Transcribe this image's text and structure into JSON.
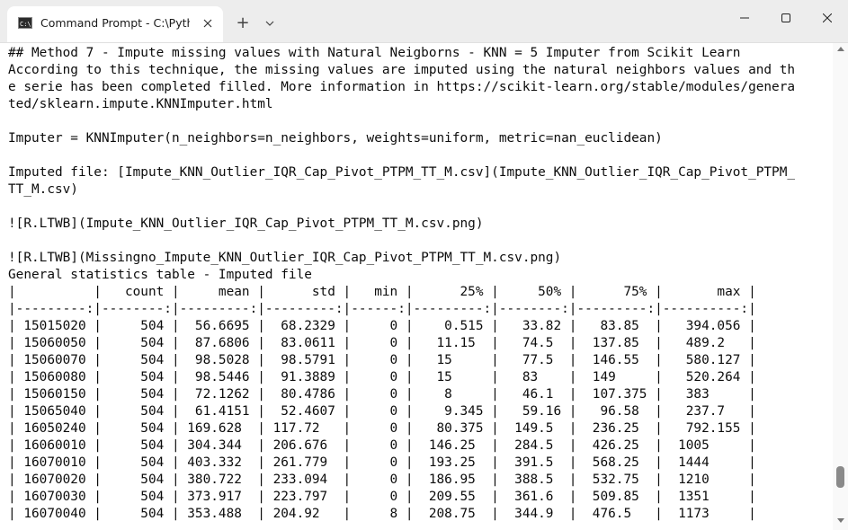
{
  "tab": {
    "title": "Command Prompt - C:\\Python",
    "icon": "cmd-icon",
    "close_icon": "close-icon"
  },
  "titlebar": {
    "new_tab_label": "+",
    "dropdown_icon": "chevron-down-icon",
    "minimize_icon": "minimize-icon",
    "maximize_icon": "maximize-icon",
    "close_icon": "close-icon"
  },
  "terminal": {
    "lines": [
      "## Method 7 - Impute missing values with Natural Neigborns - KNN = 5 Imputer from Scikit Learn",
      "According to this technique, the missing values are imputed using the natural neighbors values and th",
      "e serie has been completed filled. More information in https://scikit-learn.org/stable/modules/genera",
      "ted/sklearn.impute.KNNImputer.html",
      "",
      "Imputer = KNNImputer(n_neighbors=n_neighbors, weights=uniform, metric=nan_euclidean)",
      "",
      "Imputed file: [Impute_KNN_Outlier_IQR_Cap_Pivot_PTPM_TT_M.csv](Impute_KNN_Outlier_IQR_Cap_Pivot_PTPM_",
      "TT_M.csv)",
      "",
      "![R.LTWB](Impute_KNN_Outlier_IQR_Cap_Pivot_PTPM_TT_M.csv.png)",
      "",
      "![R.LTWB](Missingno_Impute_KNN_Outlier_IQR_Cap_Pivot_PTPM_TT_M.csv.png)",
      "General statistics table - Imputed file",
      "|          |   count |     mean |      std |   min |      25% |     50% |      75% |       max |",
      "|---------:|--------:|---------:|---------:|------:|---------:|--------:|---------:|----------:|",
      "| 15015020 |     504 |  56.6695 |  68.2329 |     0 |    0.515 |   33.82 |   83.85  |   394.056 |",
      "| 15060050 |     504 |  87.6806 |  83.0611 |     0 |   11.15  |   74.5  |  137.85  |   489.2   |",
      "| 15060070 |     504 |  98.5028 |  98.5791 |     0 |   15     |   77.5  |  146.55  |   580.127 |",
      "| 15060080 |     504 |  98.5446 |  91.3889 |     0 |   15     |   83    |  149     |   520.264 |",
      "| 15060150 |     504 |  72.1262 |  80.4786 |     0 |    8     |   46.1  |  107.375 |   383     |",
      "| 15065040 |     504 |  61.4151 |  52.4607 |     0 |    9.345 |   59.16 |   96.58  |   237.7   |",
      "| 16050240 |     504 | 169.628  | 117.72   |     0 |   80.375 |  149.5  |  236.25  |   792.155 |",
      "| 16060010 |     504 | 304.344  | 206.676  |     0 |  146.25  |  284.5  |  426.25  |  1005     |",
      "| 16070010 |     504 | 403.332  | 261.779  |     0 |  193.25  |  391.5  |  568.25  |  1444     |",
      "| 16070020 |     504 | 380.722  | 233.094  |     0 |  186.95  |  388.5  |  532.75  |  1210     |",
      "| 16070030 |     504 | 373.917  | 223.797  |     0 |  209.55  |  361.6  |  509.85  |  1351     |",
      "| 16070040 |     504 | 353.488  | 204.92   |     8 |  208.75  |  344.9  |  476.5   |  1173     |"
    ]
  },
  "scrollbar": {
    "position_fraction": 0.93
  }
}
